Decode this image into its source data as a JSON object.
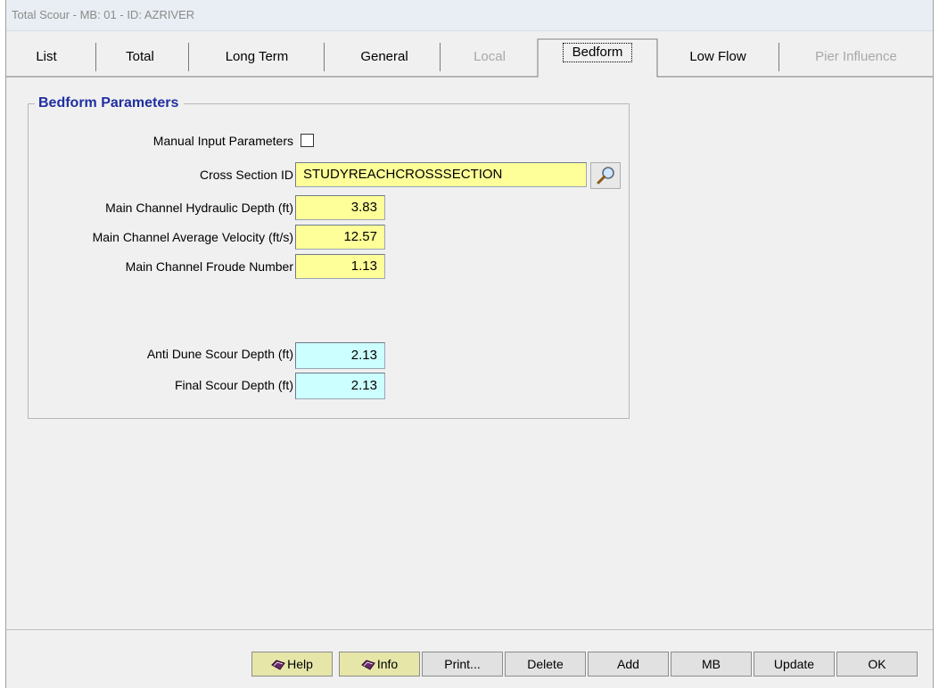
{
  "window": {
    "title": "Total Scour - MB: 01 - ID: AZRIVER"
  },
  "tabs": [
    {
      "label": "List",
      "state": "normal"
    },
    {
      "label": "Total",
      "state": "normal"
    },
    {
      "label": "Long Term",
      "state": "normal"
    },
    {
      "label": "General",
      "state": "normal"
    },
    {
      "label": "Local",
      "state": "disabled"
    },
    {
      "label": "Bedform",
      "state": "active"
    },
    {
      "label": "Low Flow",
      "state": "normal"
    },
    {
      "label": "Pier Influence",
      "state": "disabled"
    }
  ],
  "group": {
    "title": "Bedform  Parameters"
  },
  "fields": {
    "manual_input": {
      "label": "Manual Input Parameters",
      "checked": false
    },
    "cross_section": {
      "label": "Cross Section ID",
      "value": "STUDYREACHCROSSSECTION"
    },
    "hydraulic_depth": {
      "label": "Main Channel Hydraulic Depth (ft)",
      "value": "3.83"
    },
    "average_velocity": {
      "label": "Main Channel Average Velocity (ft/s)",
      "value": "12.57"
    },
    "froude_number": {
      "label": "Main Channel Froude Number",
      "value": "1.13"
    },
    "anti_dune_scour": {
      "label": "Anti Dune Scour Depth (ft)",
      "value": "2.13"
    },
    "final_scour": {
      "label": "Final Scour Depth (ft)",
      "value": "2.13"
    }
  },
  "colors": {
    "input_yellow": "#ffff99",
    "output_cyan": "#ccffff",
    "group_title": "#1f2fa0"
  },
  "buttons": {
    "help": "Help",
    "info": "Info",
    "print": "Print...",
    "delete": "Delete",
    "add": "Add",
    "mb": "MB",
    "update": "Update",
    "ok": "OK"
  }
}
